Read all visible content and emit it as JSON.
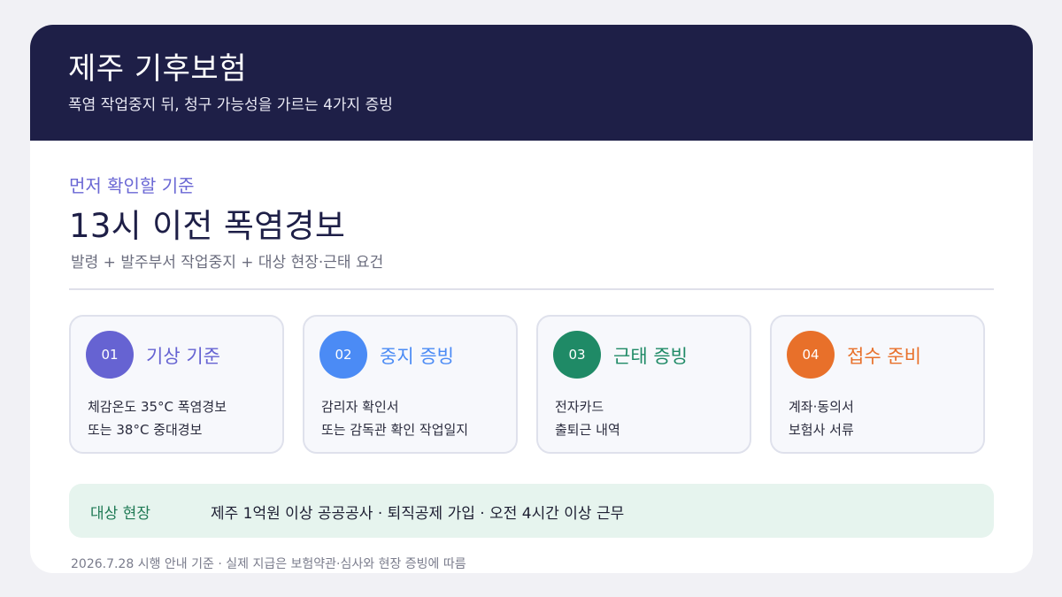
{
  "header": {
    "title": "제주 기후보험",
    "subtitle": "폭염 작업중지 뒤, 청구 가능성을 가르는 4가지 증빙"
  },
  "criteria": {
    "eyebrow": "먼저 확인할 기준",
    "headline": "13시 이전 폭염경보",
    "note": "발령 + 발주부서 작업중지 + 대상 현장·근태 요건"
  },
  "steps": [
    {
      "num": "01",
      "name": "기상 기준",
      "line1": "체감온도 35°C 폭염경보",
      "line2": "또는 38°C 중대경보",
      "color": "#6663d2"
    },
    {
      "num": "02",
      "name": "중지 증빙",
      "line1": "감리자 확인서",
      "line2": "또는 감독관 확인 작업일지",
      "color": "#4b8bf5"
    },
    {
      "num": "03",
      "name": "근태 증빙",
      "line1": "전자카드",
      "line2": "출퇴근 내역",
      "color": "#1f8a66"
    },
    {
      "num": "04",
      "name": "접수 준비",
      "line1": "계좌·동의서",
      "line2": "보험사 서류",
      "color": "#e8702a"
    }
  ],
  "target": {
    "label": "대상 현장",
    "value": "제주 1억원 이상 공공공사 · 퇴직공제 가입 · 오전 4시간 이상 근무"
  },
  "footnote": "2026.7.28 시행 안내 기준 · 실제 지급은 보험약관·심사와 현장 증빙에 따름"
}
